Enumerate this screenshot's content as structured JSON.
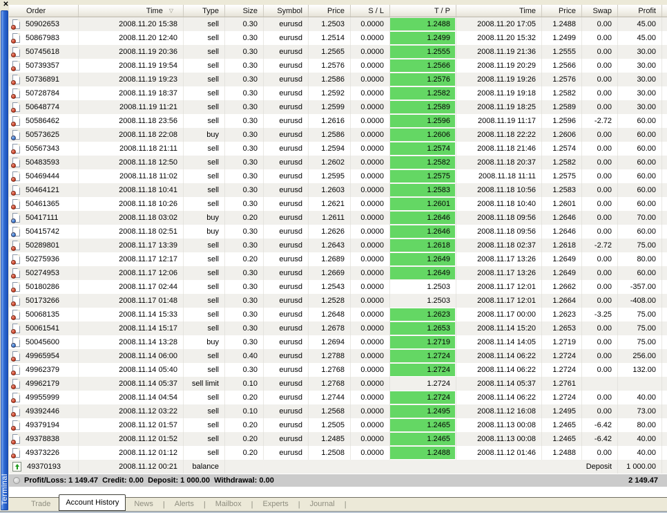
{
  "window": {
    "sidebar_label": "Terminal",
    "close_glyph": "✕"
  },
  "colors": {
    "tp_highlight": "#64d764",
    "sell_icon": "#c23a1e",
    "buy_icon": "#2a6cc8",
    "sidebar_blue": "#2e6ad2",
    "summary_bg": "#cbcbcb"
  },
  "icons": {
    "close": "close-icon",
    "sell_order": "sell-order-icon",
    "buy_order": "buy-order-icon",
    "balance_deposit": "balance-deposit-icon",
    "sort_desc_glyph": "▽",
    "summary_status": "status-icon"
  },
  "table": {
    "columns": [
      {
        "key": "order",
        "label": "Order"
      },
      {
        "key": "time",
        "label": "Time",
        "sort": true
      },
      {
        "key": "type",
        "label": "Type"
      },
      {
        "key": "size",
        "label": "Size"
      },
      {
        "key": "symbol",
        "label": "Symbol"
      },
      {
        "key": "price",
        "label": "Price"
      },
      {
        "key": "sl",
        "label": "S / L"
      },
      {
        "key": "tp",
        "label": "T / P"
      },
      {
        "key": "time2",
        "label": "Time"
      },
      {
        "key": "price2",
        "label": "Price"
      },
      {
        "key": "swap",
        "label": "Swap"
      },
      {
        "key": "profit",
        "label": "Profit"
      }
    ],
    "rows": [
      {
        "order": "50902653",
        "open_time": "2008.11.20 15:38",
        "type": "sell",
        "size": "0.30",
        "symbol": "eurusd",
        "open_price": "1.2503",
        "sl": "0.0000",
        "tp": "1.2488",
        "tp_hit": true,
        "close_time": "2008.11.20 17:05",
        "close_price": "1.2488",
        "swap": "0.00",
        "profit": "45.00"
      },
      {
        "order": "50867983",
        "open_time": "2008.11.20 12:40",
        "type": "sell",
        "size": "0.30",
        "symbol": "eurusd",
        "open_price": "1.2514",
        "sl": "0.0000",
        "tp": "1.2499",
        "tp_hit": true,
        "close_time": "2008.11.20 15:32",
        "close_price": "1.2499",
        "swap": "0.00",
        "profit": "45.00"
      },
      {
        "order": "50745618",
        "open_time": "2008.11.19 20:36",
        "type": "sell",
        "size": "0.30",
        "symbol": "eurusd",
        "open_price": "1.2565",
        "sl": "0.0000",
        "tp": "1.2555",
        "tp_hit": true,
        "close_time": "2008.11.19 21:36",
        "close_price": "1.2555",
        "swap": "0.00",
        "profit": "30.00"
      },
      {
        "order": "50739357",
        "open_time": "2008.11.19 19:54",
        "type": "sell",
        "size": "0.30",
        "symbol": "eurusd",
        "open_price": "1.2576",
        "sl": "0.0000",
        "tp": "1.2566",
        "tp_hit": true,
        "close_time": "2008.11.19 20:29",
        "close_price": "1.2566",
        "swap": "0.00",
        "profit": "30.00"
      },
      {
        "order": "50736891",
        "open_time": "2008.11.19 19:23",
        "type": "sell",
        "size": "0.30",
        "symbol": "eurusd",
        "open_price": "1.2586",
        "sl": "0.0000",
        "tp": "1.2576",
        "tp_hit": true,
        "close_time": "2008.11.19 19:26",
        "close_price": "1.2576",
        "swap": "0.00",
        "profit": "30.00"
      },
      {
        "order": "50728784",
        "open_time": "2008.11.19 18:37",
        "type": "sell",
        "size": "0.30",
        "symbol": "eurusd",
        "open_price": "1.2592",
        "sl": "0.0000",
        "tp": "1.2582",
        "tp_hit": true,
        "close_time": "2008.11.19 19:18",
        "close_price": "1.2582",
        "swap": "0.00",
        "profit": "30.00"
      },
      {
        "order": "50648774",
        "open_time": "2008.11.19 11:21",
        "type": "sell",
        "size": "0.30",
        "symbol": "eurusd",
        "open_price": "1.2599",
        "sl": "0.0000",
        "tp": "1.2589",
        "tp_hit": true,
        "close_time": "2008.11.19 18:25",
        "close_price": "1.2589",
        "swap": "0.00",
        "profit": "30.00"
      },
      {
        "order": "50586462",
        "open_time": "2008.11.18 23:56",
        "type": "sell",
        "size": "0.30",
        "symbol": "eurusd",
        "open_price": "1.2616",
        "sl": "0.0000",
        "tp": "1.2596",
        "tp_hit": true,
        "close_time": "2008.11.19 11:17",
        "close_price": "1.2596",
        "swap": "-2.72",
        "profit": "60.00"
      },
      {
        "order": "50573625",
        "open_time": "2008.11.18 22:08",
        "type": "buy",
        "size": "0.30",
        "symbol": "eurusd",
        "open_price": "1.2586",
        "sl": "0.0000",
        "tp": "1.2606",
        "tp_hit": true,
        "close_time": "2008.11.18 22:22",
        "close_price": "1.2606",
        "swap": "0.00",
        "profit": "60.00"
      },
      {
        "order": "50567343",
        "open_time": "2008.11.18 21:11",
        "type": "sell",
        "size": "0.30",
        "symbol": "eurusd",
        "open_price": "1.2594",
        "sl": "0.0000",
        "tp": "1.2574",
        "tp_hit": true,
        "close_time": "2008.11.18 21:46",
        "close_price": "1.2574",
        "swap": "0.00",
        "profit": "60.00"
      },
      {
        "order": "50483593",
        "open_time": "2008.11.18 12:50",
        "type": "sell",
        "size": "0.30",
        "symbol": "eurusd",
        "open_price": "1.2602",
        "sl": "0.0000",
        "tp": "1.2582",
        "tp_hit": true,
        "close_time": "2008.11.18 20:37",
        "close_price": "1.2582",
        "swap": "0.00",
        "profit": "60.00"
      },
      {
        "order": "50469444",
        "open_time": "2008.11.18 11:02",
        "type": "sell",
        "size": "0.30",
        "symbol": "eurusd",
        "open_price": "1.2595",
        "sl": "0.0000",
        "tp": "1.2575",
        "tp_hit": true,
        "close_time": "2008.11.18 11:11",
        "close_price": "1.2575",
        "swap": "0.00",
        "profit": "60.00"
      },
      {
        "order": "50464121",
        "open_time": "2008.11.18 10:41",
        "type": "sell",
        "size": "0.30",
        "symbol": "eurusd",
        "open_price": "1.2603",
        "sl": "0.0000",
        "tp": "1.2583",
        "tp_hit": true,
        "close_time": "2008.11.18 10:56",
        "close_price": "1.2583",
        "swap": "0.00",
        "profit": "60.00"
      },
      {
        "order": "50461365",
        "open_time": "2008.11.18 10:26",
        "type": "sell",
        "size": "0.30",
        "symbol": "eurusd",
        "open_price": "1.2621",
        "sl": "0.0000",
        "tp": "1.2601",
        "tp_hit": true,
        "close_time": "2008.11.18 10:40",
        "close_price": "1.2601",
        "swap": "0.00",
        "profit": "60.00"
      },
      {
        "order": "50417111",
        "open_time": "2008.11.18 03:02",
        "type": "buy",
        "size": "0.20",
        "symbol": "eurusd",
        "open_price": "1.2611",
        "sl": "0.0000",
        "tp": "1.2646",
        "tp_hit": true,
        "close_time": "2008.11.18 09:56",
        "close_price": "1.2646",
        "swap": "0.00",
        "profit": "70.00"
      },
      {
        "order": "50415742",
        "open_time": "2008.11.18 02:51",
        "type": "buy",
        "size": "0.30",
        "symbol": "eurusd",
        "open_price": "1.2626",
        "sl": "0.0000",
        "tp": "1.2646",
        "tp_hit": true,
        "close_time": "2008.11.18 09:56",
        "close_price": "1.2646",
        "swap": "0.00",
        "profit": "60.00"
      },
      {
        "order": "50289801",
        "open_time": "2008.11.17 13:39",
        "type": "sell",
        "size": "0.30",
        "symbol": "eurusd",
        "open_price": "1.2643",
        "sl": "0.0000",
        "tp": "1.2618",
        "tp_hit": true,
        "close_time": "2008.11.18 02:37",
        "close_price": "1.2618",
        "swap": "-2.72",
        "profit": "75.00"
      },
      {
        "order": "50275936",
        "open_time": "2008.11.17 12:17",
        "type": "sell",
        "size": "0.20",
        "symbol": "eurusd",
        "open_price": "1.2689",
        "sl": "0.0000",
        "tp": "1.2649",
        "tp_hit": true,
        "close_time": "2008.11.17 13:26",
        "close_price": "1.2649",
        "swap": "0.00",
        "profit": "80.00"
      },
      {
        "order": "50274953",
        "open_time": "2008.11.17 12:06",
        "type": "sell",
        "size": "0.30",
        "symbol": "eurusd",
        "open_price": "1.2669",
        "sl": "0.0000",
        "tp": "1.2649",
        "tp_hit": true,
        "close_time": "2008.11.17 13:26",
        "close_price": "1.2649",
        "swap": "0.00",
        "profit": "60.00"
      },
      {
        "order": "50180286",
        "open_time": "2008.11.17 02:44",
        "type": "sell",
        "size": "0.30",
        "symbol": "eurusd",
        "open_price": "1.2543",
        "sl": "0.0000",
        "tp": "1.2503",
        "tp_hit": false,
        "close_time": "2008.11.17 12:01",
        "close_price": "1.2662",
        "swap": "0.00",
        "profit": "-357.00"
      },
      {
        "order": "50173266",
        "open_time": "2008.11.17 01:48",
        "type": "sell",
        "size": "0.30",
        "symbol": "eurusd",
        "open_price": "1.2528",
        "sl": "0.0000",
        "tp": "1.2503",
        "tp_hit": false,
        "close_time": "2008.11.17 12:01",
        "close_price": "1.2664",
        "swap": "0.00",
        "profit": "-408.00"
      },
      {
        "order": "50068135",
        "open_time": "2008.11.14 15:33",
        "type": "sell",
        "size": "0.30",
        "symbol": "eurusd",
        "open_price": "1.2648",
        "sl": "0.0000",
        "tp": "1.2623",
        "tp_hit": true,
        "close_time": "2008.11.17 00:00",
        "close_price": "1.2623",
        "swap": "-3.25",
        "profit": "75.00"
      },
      {
        "order": "50061541",
        "open_time": "2008.11.14 15:17",
        "type": "sell",
        "size": "0.30",
        "symbol": "eurusd",
        "open_price": "1.2678",
        "sl": "0.0000",
        "tp": "1.2653",
        "tp_hit": true,
        "close_time": "2008.11.14 15:20",
        "close_price": "1.2653",
        "swap": "0.00",
        "profit": "75.00"
      },
      {
        "order": "50045600",
        "open_time": "2008.11.14 13:28",
        "type": "buy",
        "size": "0.30",
        "symbol": "eurusd",
        "open_price": "1.2694",
        "sl": "0.0000",
        "tp": "1.2719",
        "tp_hit": true,
        "close_time": "2008.11.14 14:05",
        "close_price": "1.2719",
        "swap": "0.00",
        "profit": "75.00"
      },
      {
        "order": "49965954",
        "open_time": "2008.11.14 06:00",
        "type": "sell",
        "size": "0.40",
        "symbol": "eurusd",
        "open_price": "1.2788",
        "sl": "0.0000",
        "tp": "1.2724",
        "tp_hit": true,
        "close_time": "2008.11.14 06:22",
        "close_price": "1.2724",
        "swap": "0.00",
        "profit": "256.00"
      },
      {
        "order": "49962379",
        "open_time": "2008.11.14 05:40",
        "type": "sell",
        "size": "0.30",
        "symbol": "eurusd",
        "open_price": "1.2768",
        "sl": "0.0000",
        "tp": "1.2724",
        "tp_hit": true,
        "close_time": "2008.11.14 06:22",
        "close_price": "1.2724",
        "swap": "0.00",
        "profit": "132.00"
      },
      {
        "order": "49962179",
        "open_time": "2008.11.14 05:37",
        "type": "sell limit",
        "size": "0.10",
        "symbol": "eurusd",
        "open_price": "1.2768",
        "sl": "0.0000",
        "tp": "1.2724",
        "tp_hit": false,
        "close_time": "2008.11.14 05:37",
        "close_price": "1.2761",
        "swap": "",
        "profit": ""
      },
      {
        "order": "49955999",
        "open_time": "2008.11.14 04:54",
        "type": "sell",
        "size": "0.20",
        "symbol": "eurusd",
        "open_price": "1.2744",
        "sl": "0.0000",
        "tp": "1.2724",
        "tp_hit": true,
        "close_time": "2008.11.14 06:22",
        "close_price": "1.2724",
        "swap": "0.00",
        "profit": "40.00"
      },
      {
        "order": "49392446",
        "open_time": "2008.11.12 03:22",
        "type": "sell",
        "size": "0.10",
        "symbol": "eurusd",
        "open_price": "1.2568",
        "sl": "0.0000",
        "tp": "1.2495",
        "tp_hit": true,
        "close_time": "2008.11.12 16:08",
        "close_price": "1.2495",
        "swap": "0.00",
        "profit": "73.00"
      },
      {
        "order": "49379194",
        "open_time": "2008.11.12 01:57",
        "type": "sell",
        "size": "0.20",
        "symbol": "eurusd",
        "open_price": "1.2505",
        "sl": "0.0000",
        "tp": "1.2465",
        "tp_hit": true,
        "close_time": "2008.11.13 00:08",
        "close_price": "1.2465",
        "swap": "-6.42",
        "profit": "80.00"
      },
      {
        "order": "49378838",
        "open_time": "2008.11.12 01:52",
        "type": "sell",
        "size": "0.20",
        "symbol": "eurusd",
        "open_price": "1.2485",
        "sl": "0.0000",
        "tp": "1.2465",
        "tp_hit": true,
        "close_time": "2008.11.13 00:08",
        "close_price": "1.2465",
        "swap": "-6.42",
        "profit": "40.00"
      },
      {
        "order": "49373226",
        "open_time": "2008.11.12 01:12",
        "type": "sell",
        "size": "0.20",
        "symbol": "eurusd",
        "open_price": "1.2508",
        "sl": "0.0000",
        "tp": "1.2488",
        "tp_hit": true,
        "close_time": "2008.11.12 01:46",
        "close_price": "1.2488",
        "swap": "0.00",
        "profit": "40.00"
      },
      {
        "order": "49370193",
        "open_time": "2008.11.12 00:21",
        "type": "balance",
        "balance_label": "Deposit",
        "profit": "1 000.00"
      }
    ]
  },
  "summary": {
    "text": "Profit/Loss: 1 149.47  Credit: 0.00  Deposit: 1 000.00  Withdrawal: 0.00",
    "total": "2 149.47"
  },
  "tabs": {
    "items": [
      {
        "label": "Trade",
        "active": false,
        "sep": false
      },
      {
        "label": "Account History",
        "active": true,
        "sep": false
      },
      {
        "label": "News",
        "active": false,
        "sep": true
      },
      {
        "label": "Alerts",
        "active": false,
        "sep": true
      },
      {
        "label": "Mailbox",
        "active": false,
        "sep": true
      },
      {
        "label": "Experts",
        "active": false,
        "sep": true
      },
      {
        "label": "Journal",
        "active": false,
        "sep": true
      }
    ]
  }
}
